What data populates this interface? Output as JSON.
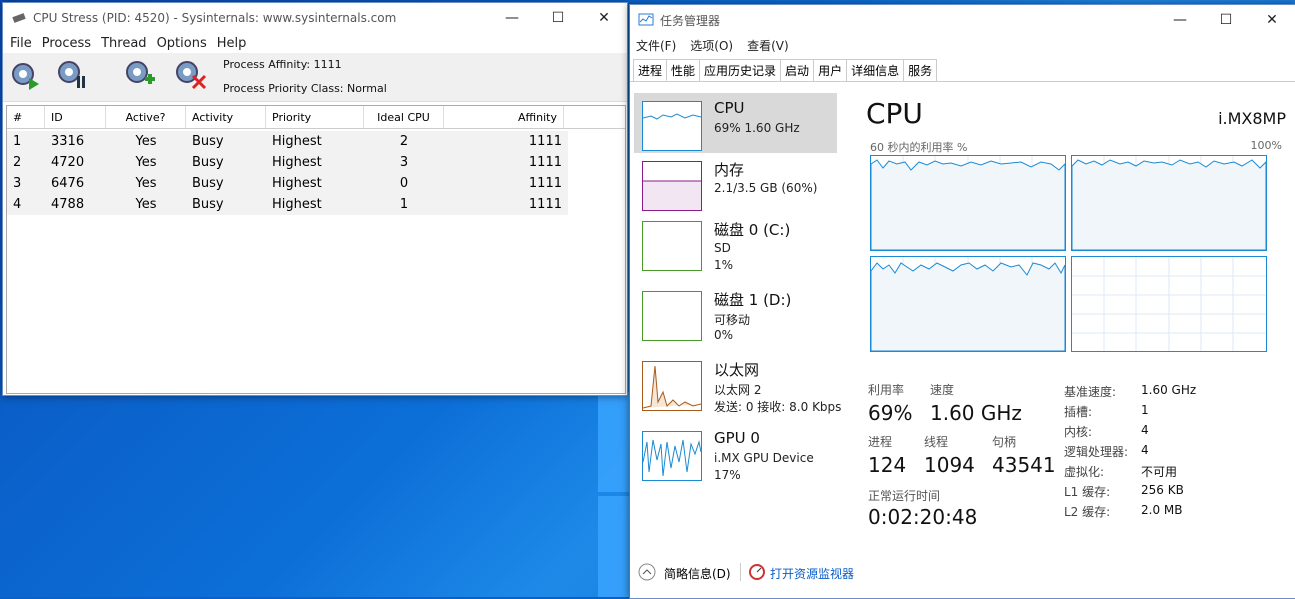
{
  "stress": {
    "title": "CPU Stress (PID: 4520) - Sysinternals: www.sysinternals.com",
    "menu": [
      "File",
      "Process",
      "Thread",
      "Options",
      "Help"
    ],
    "toolbar_buttons": [
      "start-threads-icon",
      "thread-settings-icon",
      "add-thread-icon",
      "remove-thread-icon"
    ],
    "affinity": "Process Affinity: 1111",
    "priority_class": "Process Priority Class: Normal",
    "columns": [
      "#",
      "ID",
      "Active?",
      "Activity",
      "Priority",
      "Ideal CPU",
      "Affinity"
    ],
    "rows": [
      [
        "1",
        "3316",
        "Yes",
        "Busy",
        "Highest",
        "2",
        "1111"
      ],
      [
        "2",
        "4720",
        "Yes",
        "Busy",
        "Highest",
        "3",
        "1111"
      ],
      [
        "3",
        "6476",
        "Yes",
        "Busy",
        "Highest",
        "0",
        "1111"
      ],
      [
        "4",
        "4788",
        "Yes",
        "Busy",
        "Highest",
        "1",
        "1111"
      ]
    ]
  },
  "taskmgr": {
    "title": "任务管理器",
    "menu": [
      "文件(F)",
      "选项(O)",
      "查看(V)"
    ],
    "tabs": [
      "进程",
      "性能",
      "应用历史记录",
      "启动",
      "用户",
      "详细信息",
      "服务"
    ],
    "active_tab": "性能",
    "sidebar": [
      {
        "name": "CPU",
        "sub1": "69% 1.60 GHz",
        "sub2": ""
      },
      {
        "name": "内存",
        "sub1": "2.1/3.5 GB (60%)",
        "sub2": ""
      },
      {
        "name": "磁盘 0 (C:)",
        "sub1": "SD",
        "sub2": "1%"
      },
      {
        "name": "磁盘 1 (D:)",
        "sub1": "可移动",
        "sub2": "0%"
      },
      {
        "name": "以太网",
        "sub1": "以太网 2",
        "sub2": "发送: 0 接收: 8.0 Kbps"
      },
      {
        "name": "GPU 0",
        "sub1": "i.MX GPU Device",
        "sub2": "17%"
      }
    ],
    "main": {
      "title": "CPU",
      "device": "i.MX8MP",
      "graph_label": "60 秒内的利用率 %",
      "graph_max": "100%",
      "stats": {
        "util_label": "利用率",
        "util": "69%",
        "speed_label": "速度",
        "speed": "1.60 GHz",
        "proc_label": "进程",
        "proc": "124",
        "thread_label": "线程",
        "thread": "1094",
        "handle_label": "句柄",
        "handle": "43541",
        "uptime_label": "正常运行时间",
        "uptime": "0:02:20:48"
      },
      "details": [
        {
          "k": "基准速度:",
          "v": "1.60 GHz"
        },
        {
          "k": "插槽:",
          "v": "1"
        },
        {
          "k": "内核:",
          "v": "4"
        },
        {
          "k": "逻辑处理器:",
          "v": "4"
        },
        {
          "k": "虚拟化:",
          "v": "不可用"
        },
        {
          "k": "L1 缓存:",
          "v": "256 KB"
        },
        {
          "k": "L2 缓存:",
          "v": "2.0 MB"
        }
      ]
    },
    "footer": {
      "fewer_details": "简略信息(D)",
      "open_monitor": "打开资源监视器"
    }
  }
}
